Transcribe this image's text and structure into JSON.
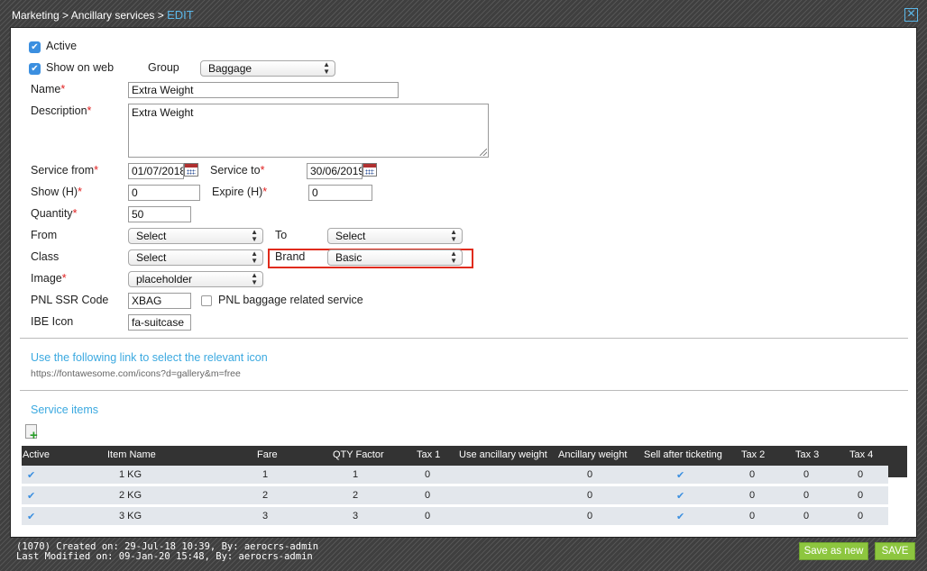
{
  "breadcrumb": {
    "path": "Marketing > Ancillary services > ",
    "current": "EDIT"
  },
  "close_icon": "close-icon",
  "form": {
    "active_label": "Active",
    "show_on_web_label": "Show on web",
    "group_label": "Group",
    "group_value": "Baggage",
    "name_label": "Name",
    "name_value": "Extra Weight",
    "description_label": "Description",
    "description_value": "Extra Weight",
    "service_from_label": "Service from",
    "service_from_value": "01/07/2018",
    "service_to_label": "Service to",
    "service_to_value": "30/06/2019",
    "show_h_label": "Show (H)",
    "show_h_value": "0",
    "expire_h_label": "Expire (H)",
    "expire_h_value": "0",
    "quantity_label": "Quantity",
    "quantity_value": "50",
    "from_label": "From",
    "from_value": "Select",
    "to_label": "To",
    "to_value": "Select",
    "class_label": "Class",
    "class_value": "Select",
    "brand_label": "Brand",
    "brand_value": "Basic",
    "image_label": "Image",
    "image_value": "placeholder",
    "pnl_ssr_label": "PNL SSR Code",
    "pnl_ssr_value": "XBAG",
    "pnl_baggage_label": "PNL baggage related service",
    "ibe_icon_label": "IBE Icon",
    "ibe_icon_value": "fa-suitcase",
    "required_mark": "*"
  },
  "icon_link": {
    "text": "Use the following link to select the relevant icon",
    "url": "https://fontawesome.com/icons?d=gallery&m=free"
  },
  "service_items": {
    "title": "Service items",
    "columns": [
      "Active",
      "Item Name",
      "Fare",
      "QTY Factor",
      "Tax 1",
      "Use ancillary weight",
      "Ancillary weight",
      "Sell after ticketing",
      "Tax 2",
      "Tax 3",
      "Tax 4"
    ],
    "check_glyph": "✔",
    "rows": [
      {
        "item_name": "1 KG",
        "fare": "1",
        "qty_factor": "1",
        "tax1": "0",
        "ancillary_weight": "0",
        "tax2": "0",
        "tax3": "0",
        "tax4": "0"
      },
      {
        "item_name": "2 KG",
        "fare": "2",
        "qty_factor": "2",
        "tax1": "0",
        "ancillary_weight": "0",
        "tax2": "0",
        "tax3": "0",
        "tax4": "0"
      },
      {
        "item_name": "3 KG",
        "fare": "3",
        "qty_factor": "3",
        "tax1": "0",
        "ancillary_weight": "0",
        "tax2": "0",
        "tax3": "0",
        "tax4": "0"
      }
    ]
  },
  "footer": {
    "created": "(1070) Created on: 29-Jul-18 10:39, By: aerocrs-admin",
    "modified": "Last Modified on: 09-Jan-20 15:48, By: aerocrs-admin",
    "save_as_new": "Save as new",
    "save": "SAVE"
  },
  "colors": {
    "accent": "#3ba9e0",
    "highlight": "#e02b1b",
    "button": "#8dc63f",
    "required": "#e02020"
  }
}
